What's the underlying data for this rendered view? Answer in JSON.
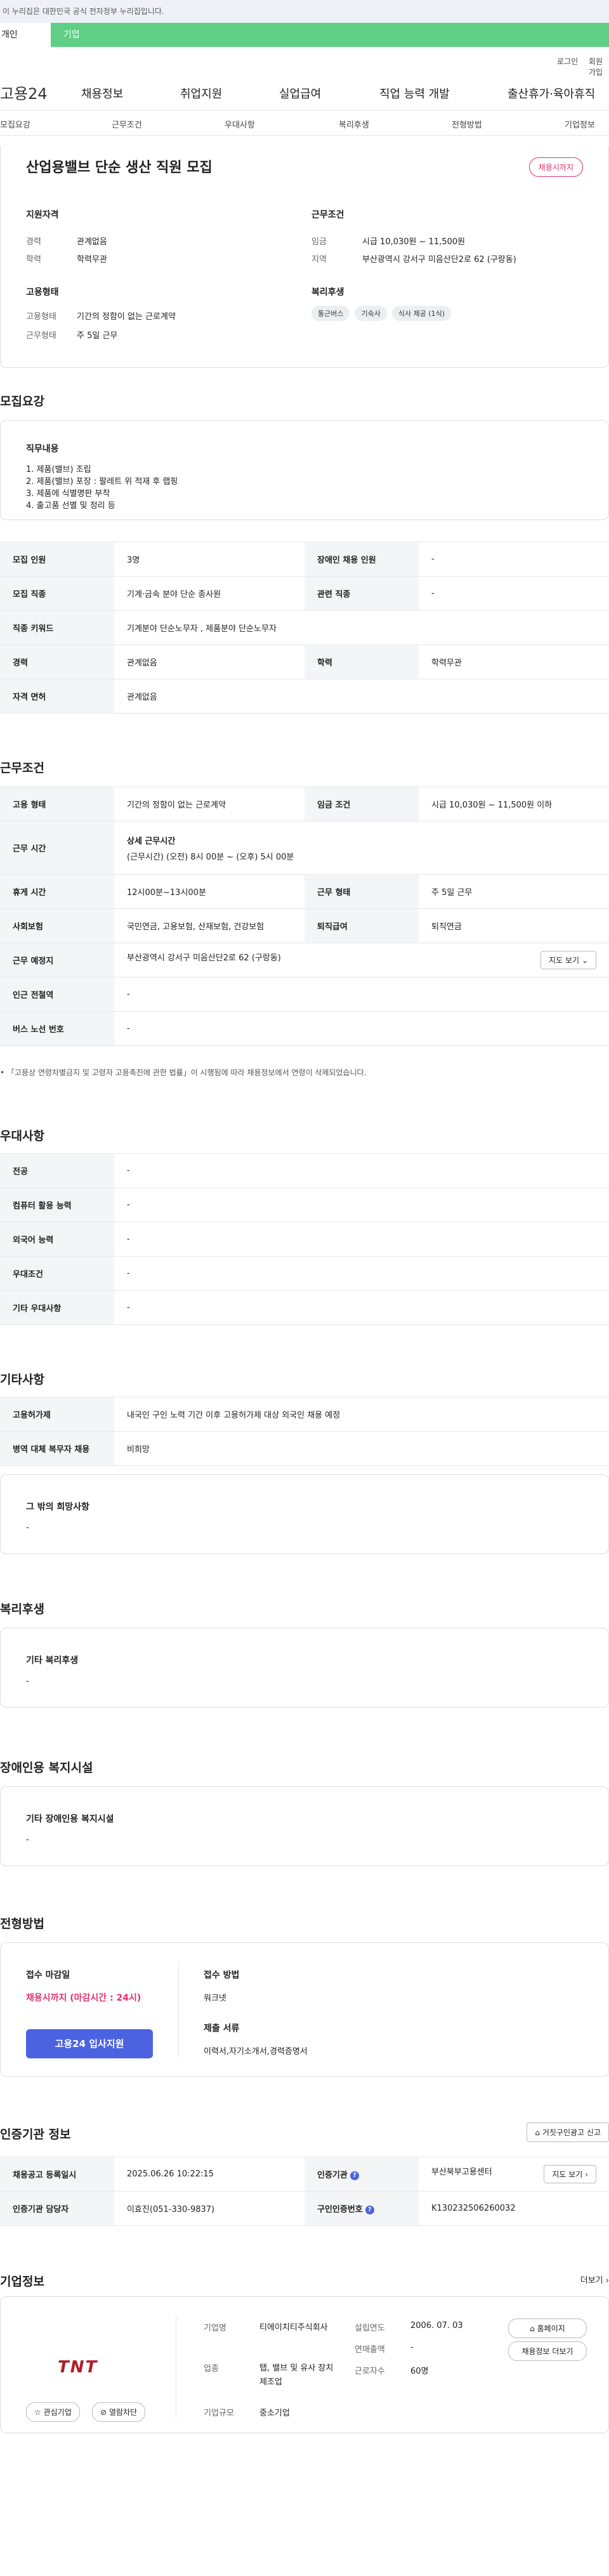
{
  "top_notice": "이 누리집은 대한민국 공식 전자정부 누리집입니다.",
  "tabs": {
    "individual": "개인",
    "corporate": "기업"
  },
  "util": {
    "login": "로그인",
    "signup": "회원가입"
  },
  "gnb": {
    "logo": "고용24",
    "menu": [
      "채용정보",
      "취업지원",
      "실업급여",
      "직업 능력 개발",
      "출산휴가·육아휴직"
    ]
  },
  "subnav": [
    "모집요강",
    "근무조건",
    "우대사항",
    "복리후생",
    "전형방법",
    "기업정보"
  ],
  "summary": {
    "title": "산업용밸브 단순 생산 직원 모집",
    "deadline_badge": "채용시까지",
    "qual_title": "지원자격",
    "qual": [
      {
        "k": "경력",
        "v": "관계없음"
      },
      {
        "k": "학력",
        "v": "학력무관"
      }
    ],
    "emp_title": "고용형태",
    "emp": [
      {
        "k": "고용형태",
        "v": "기간의 정함이 없는 근로계약"
      },
      {
        "k": "근무형태",
        "v": "주 5일 근무"
      }
    ],
    "cond_title": "근무조건",
    "cond": [
      {
        "k": "임금",
        "v": "시급 10,030원 ~ 11,500원"
      },
      {
        "k": "지역",
        "v": "부산광역시 강서구 미음산단2로 62 (구랑동)"
      }
    ],
    "welfare_title": "복리후생",
    "welfare_chips": [
      "통근버스",
      "기숙사",
      "식사 제공 (1식)"
    ]
  },
  "recruit": {
    "section_title": "모집요강",
    "duty_title": "직무내용",
    "duties": [
      "1. 제품(밸브) 조립",
      "2. 제품(밸브) 포장 : 팔레트 위 적재 후 랩핑",
      "3. 제품에 식별명판 부착",
      "4. 출고품 선별 및 정리 등"
    ],
    "rows": [
      {
        "k1": "모집 인원",
        "v1": "3명",
        "k2": "장애인 채용 인원",
        "v2": "-"
      },
      {
        "k1": "모집 직종",
        "v1": "기계·금속 분야 단순 종사원",
        "k2": "관련 직종",
        "v2": "-"
      },
      {
        "k1": "직종 키워드",
        "v1": "기계분야 단순노무자 , 제품분야 단순노무자"
      },
      {
        "k1": "경력",
        "v1": "관계없음",
        "k2": "학력",
        "v2": "학력무관"
      },
      {
        "k1": "자격 면허",
        "v1": "관계없음"
      }
    ]
  },
  "work": {
    "section_title": "근무조건",
    "emp_type_k": "고용 형태",
    "emp_type_v": "기간의 정함이 없는 근로계약",
    "wage_k": "임금 조건",
    "wage_v": "시급 10,030원 ~ 11,500원 이하",
    "hours_k": "근무 시간",
    "hours_title": "상세 근무시간",
    "hours_v": "(근무시간) (오전) 8시 00분 ~ (오후) 5시 00분",
    "rest_k": "휴게 시간",
    "rest_v": "12시00분~13시00분",
    "shift_k": "근무 형태",
    "shift_v": "주 5일 근무",
    "ins_k": "사회보험",
    "ins_v": "국민연금, 고용보험, 산재보험, 건강보험",
    "sev_k": "퇴직급여",
    "sev_v": "퇴직연금",
    "loc_k": "근무 예정지",
    "loc_v": "부산광역시 강서구 미음산단2로 62 (구랑동)",
    "map_btn": "지도 보기",
    "subway_k": "인근 전철역",
    "subway_v": "-",
    "bus_k": "버스 노선 번호",
    "bus_v": "-",
    "note": "「고용상 연령차별금지 및 고령자 고용촉진에 관한 법률」이 시행됨에 따라 채용정보에서 연령이 삭제되었습니다."
  },
  "pref": {
    "section_title": "우대사항",
    "rows": [
      {
        "k": "전공",
        "v": "-"
      },
      {
        "k": "컴퓨터 활용 능력",
        "v": "-"
      },
      {
        "k": "외국어 능력",
        "v": "-"
      },
      {
        "k": "우대조건",
        "v": "-"
      },
      {
        "k": "기타 우대사항",
        "v": "-"
      }
    ]
  },
  "etc": {
    "section_title": "기타사항",
    "rows": [
      {
        "k": "고용허가제",
        "v": "내국인 구인 노력 기간 이후 고용허가제 대상 외국인 채용 예정"
      },
      {
        "k": "병역 대체 복무자 채용",
        "v": "비희망"
      }
    ],
    "box_title": "그 밖의 희망사항",
    "box_value": "-"
  },
  "welfare": {
    "section_title": "복리후생",
    "box_title": "기타 복리후생",
    "box_value": "-"
  },
  "disabled": {
    "section_title": "장애인용 복지시설",
    "box_title": "기타 장애인용 복지시설",
    "box_value": "-"
  },
  "screening": {
    "section_title": "전형방법",
    "deadline_title": "접수 마감일",
    "deadline_value": "채용시까지 (마감시간 : 24시)",
    "apply_btn": "고용24 입사지원",
    "method_title": "접수 방법",
    "method_value": "워크넷",
    "docs_title": "제출 서류",
    "docs_value": "이력서,자기소개서,경력증명서"
  },
  "agency": {
    "section_title": "인증기관 정보",
    "report_btn": "거짓구인광고 신고",
    "reg_k": "채용공고 등록일시",
    "reg_v": "2025.06.26 10:22:15",
    "agency_k": "인증기관",
    "agency_v": "부산북부고용센터",
    "map_btn": "지도 보기",
    "staff_k": "인증기관 담당자",
    "staff_v": "이효진(051-330-9837)",
    "num_k": "구인인증번호",
    "num_v": "K130232506260032"
  },
  "company": {
    "section_title": "기업정보",
    "more": "더보기",
    "logo_text": "TNT",
    "interest_btn": "관심기업",
    "block_btn": "열람차단",
    "fields": [
      {
        "k": "기업명",
        "v": "티에이치티주식회사"
      },
      {
        "k": "업종",
        "v": "탭, 밸브 및 유사 장치 제조업"
      },
      {
        "k": "기업규모",
        "v": "중소기업"
      }
    ],
    "fields2": [
      {
        "k": "설립연도",
        "v": "2006. 07. 03"
      },
      {
        "k": "연매출액",
        "v": "-"
      },
      {
        "k": "근로자수",
        "v": "60명"
      }
    ],
    "homepage_btn": "홈페이지",
    "jobs_btn": "채용정보 더보기"
  }
}
